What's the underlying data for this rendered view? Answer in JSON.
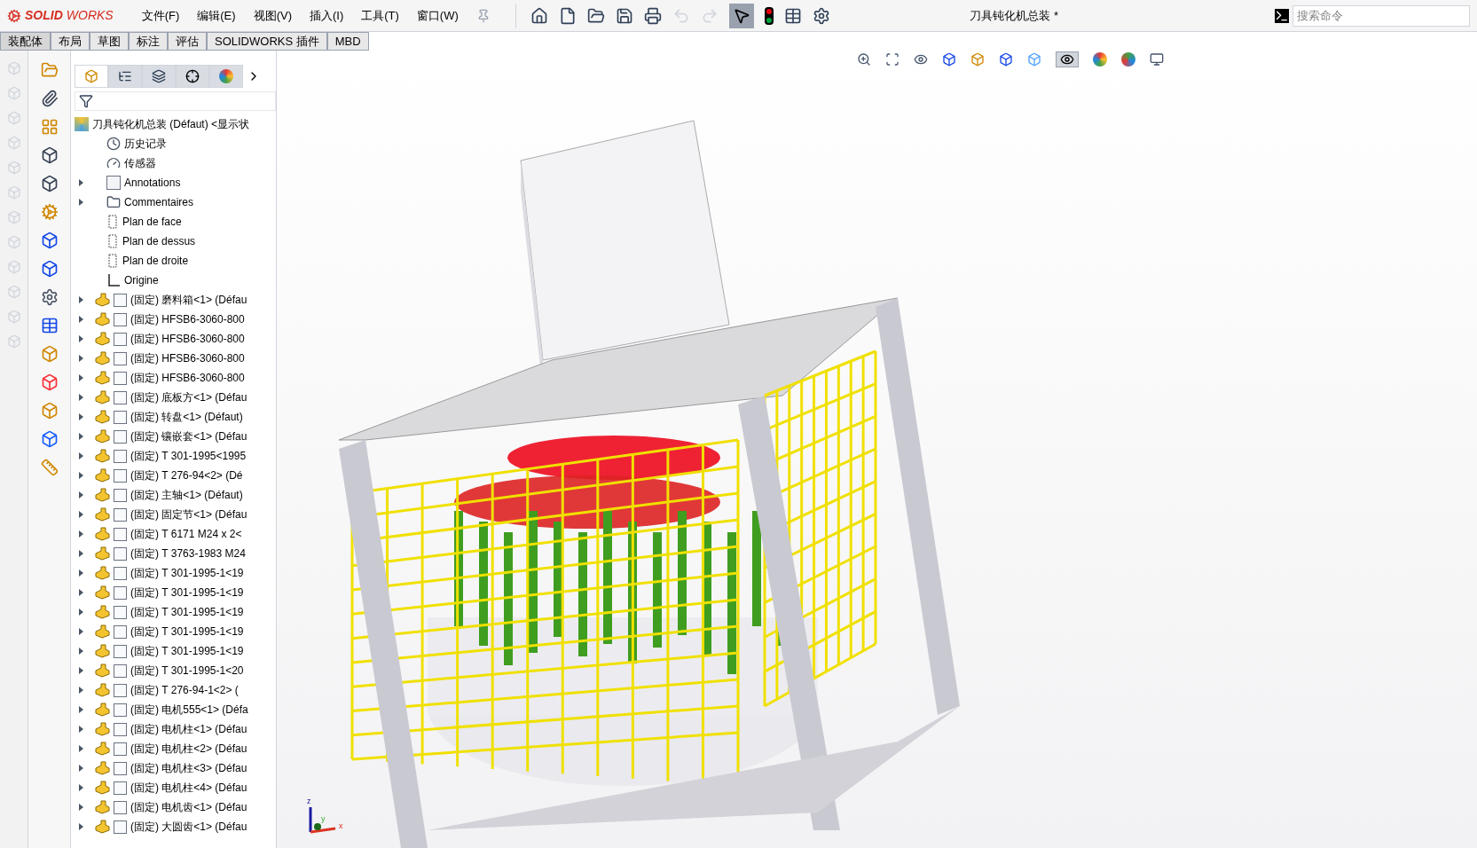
{
  "app": {
    "brand_prefix": "SOLID",
    "brand_suffix": "WORKS"
  },
  "menu": [
    "文件(F)",
    "编辑(E)",
    "视图(V)",
    "插入(I)",
    "工具(T)",
    "窗口(W)"
  ],
  "window": {
    "title": "刀具钝化机总装 *"
  },
  "search": {
    "placeholder": "搜索命令"
  },
  "command_tabs": [
    {
      "label": "装配体",
      "selected": true
    },
    {
      "label": "布局",
      "selected": false
    },
    {
      "label": "草图",
      "selected": false
    },
    {
      "label": "标注",
      "selected": false
    },
    {
      "label": "评估",
      "selected": false
    },
    {
      "label": "SOLIDWORKS 插件",
      "selected": false
    },
    {
      "label": "MBD",
      "selected": false
    }
  ],
  "panel_tabs": [
    {
      "kind": "feature",
      "selected": true
    },
    {
      "kind": "property",
      "selected": false
    },
    {
      "kind": "config",
      "selected": false
    },
    {
      "kind": "dimxpert",
      "selected": false
    },
    {
      "kind": "display",
      "selected": false
    }
  ],
  "tree": {
    "root": "刀具钝化机总装 (Défaut) <显示状",
    "items": [
      {
        "kind": "history",
        "label": "历史记录"
      },
      {
        "kind": "sensor",
        "label": "传感器"
      },
      {
        "kind": "annotations",
        "label": "Annotations",
        "expanded": false
      },
      {
        "kind": "comments",
        "label": "Commentaires",
        "expanded": false
      },
      {
        "kind": "plane",
        "label": "Plan de face"
      },
      {
        "kind": "plane",
        "label": "Plan de dessus"
      },
      {
        "kind": "plane",
        "label": "Plan de droite"
      },
      {
        "kind": "origin",
        "label": "Origine"
      },
      {
        "kind": "part",
        "label": "(固定) 磨料箱<1> (Défau",
        "expanded": false
      },
      {
        "kind": "part",
        "label": "(固定) HFSB6-3060-800",
        "expanded": false
      },
      {
        "kind": "part",
        "label": "(固定) HFSB6-3060-800",
        "expanded": false
      },
      {
        "kind": "part",
        "label": "(固定) HFSB6-3060-800",
        "expanded": false
      },
      {
        "kind": "part",
        "label": "(固定) HFSB6-3060-800",
        "expanded": false
      },
      {
        "kind": "part",
        "label": "(固定) 底板方<1> (Défau",
        "expanded": false
      },
      {
        "kind": "part",
        "label": "(固定) 转盘<1> (Défaut)",
        "expanded": false
      },
      {
        "kind": "part",
        "label": "(固定) 镶嵌套<1> (Défau",
        "expanded": false
      },
      {
        "kind": "part",
        "label": "(固定) T 301-1995<1995",
        "expanded": false
      },
      {
        "kind": "part",
        "label": "(固定) T 276-94<2> (Dé",
        "expanded": false
      },
      {
        "kind": "part",
        "label": "(固定) 主轴<1> (Défaut)",
        "expanded": false
      },
      {
        "kind": "part",
        "label": "(固定) 固定节<1> (Défau",
        "expanded": false
      },
      {
        "kind": "part",
        "label": "(固定) T 6171 M24 x 2<",
        "expanded": false
      },
      {
        "kind": "part",
        "label": "(固定) T 3763-1983 M24",
        "expanded": false
      },
      {
        "kind": "part",
        "label": "(固定) T 301-1995-1<19",
        "expanded": false
      },
      {
        "kind": "part",
        "label": "(固定) T 301-1995-1<19",
        "expanded": false
      },
      {
        "kind": "part",
        "label": "(固定) T 301-1995-1<19",
        "expanded": false
      },
      {
        "kind": "part",
        "label": "(固定) T 301-1995-1<19",
        "expanded": false
      },
      {
        "kind": "part",
        "label": "(固定) T 301-1995-1<19",
        "expanded": false
      },
      {
        "kind": "part",
        "label": "(固定) T 301-1995-1<20",
        "expanded": false
      },
      {
        "kind": "part",
        "label": "(固定) T 276-94-1<2> (",
        "expanded": false
      },
      {
        "kind": "part",
        "label": "(固定) 电机555<1> (Défa",
        "expanded": false
      },
      {
        "kind": "part",
        "label": "(固定) 电机柱<1> (Défau",
        "expanded": false
      },
      {
        "kind": "part",
        "label": "(固定) 电机柱<2> (Défau",
        "expanded": false
      },
      {
        "kind": "part",
        "label": "(固定) 电机柱<3> (Défau",
        "expanded": false
      },
      {
        "kind": "part",
        "label": "(固定) 电机柱<4> (Défau",
        "expanded": false
      },
      {
        "kind": "part",
        "label": "(固定) 电机齿<1> (Défau",
        "expanded": false
      },
      {
        "kind": "part",
        "label": "(固定) 大圆齿<1> (Défau",
        "expanded": false
      }
    ]
  },
  "triad": {
    "x": "x",
    "y": "y",
    "z": "z"
  }
}
